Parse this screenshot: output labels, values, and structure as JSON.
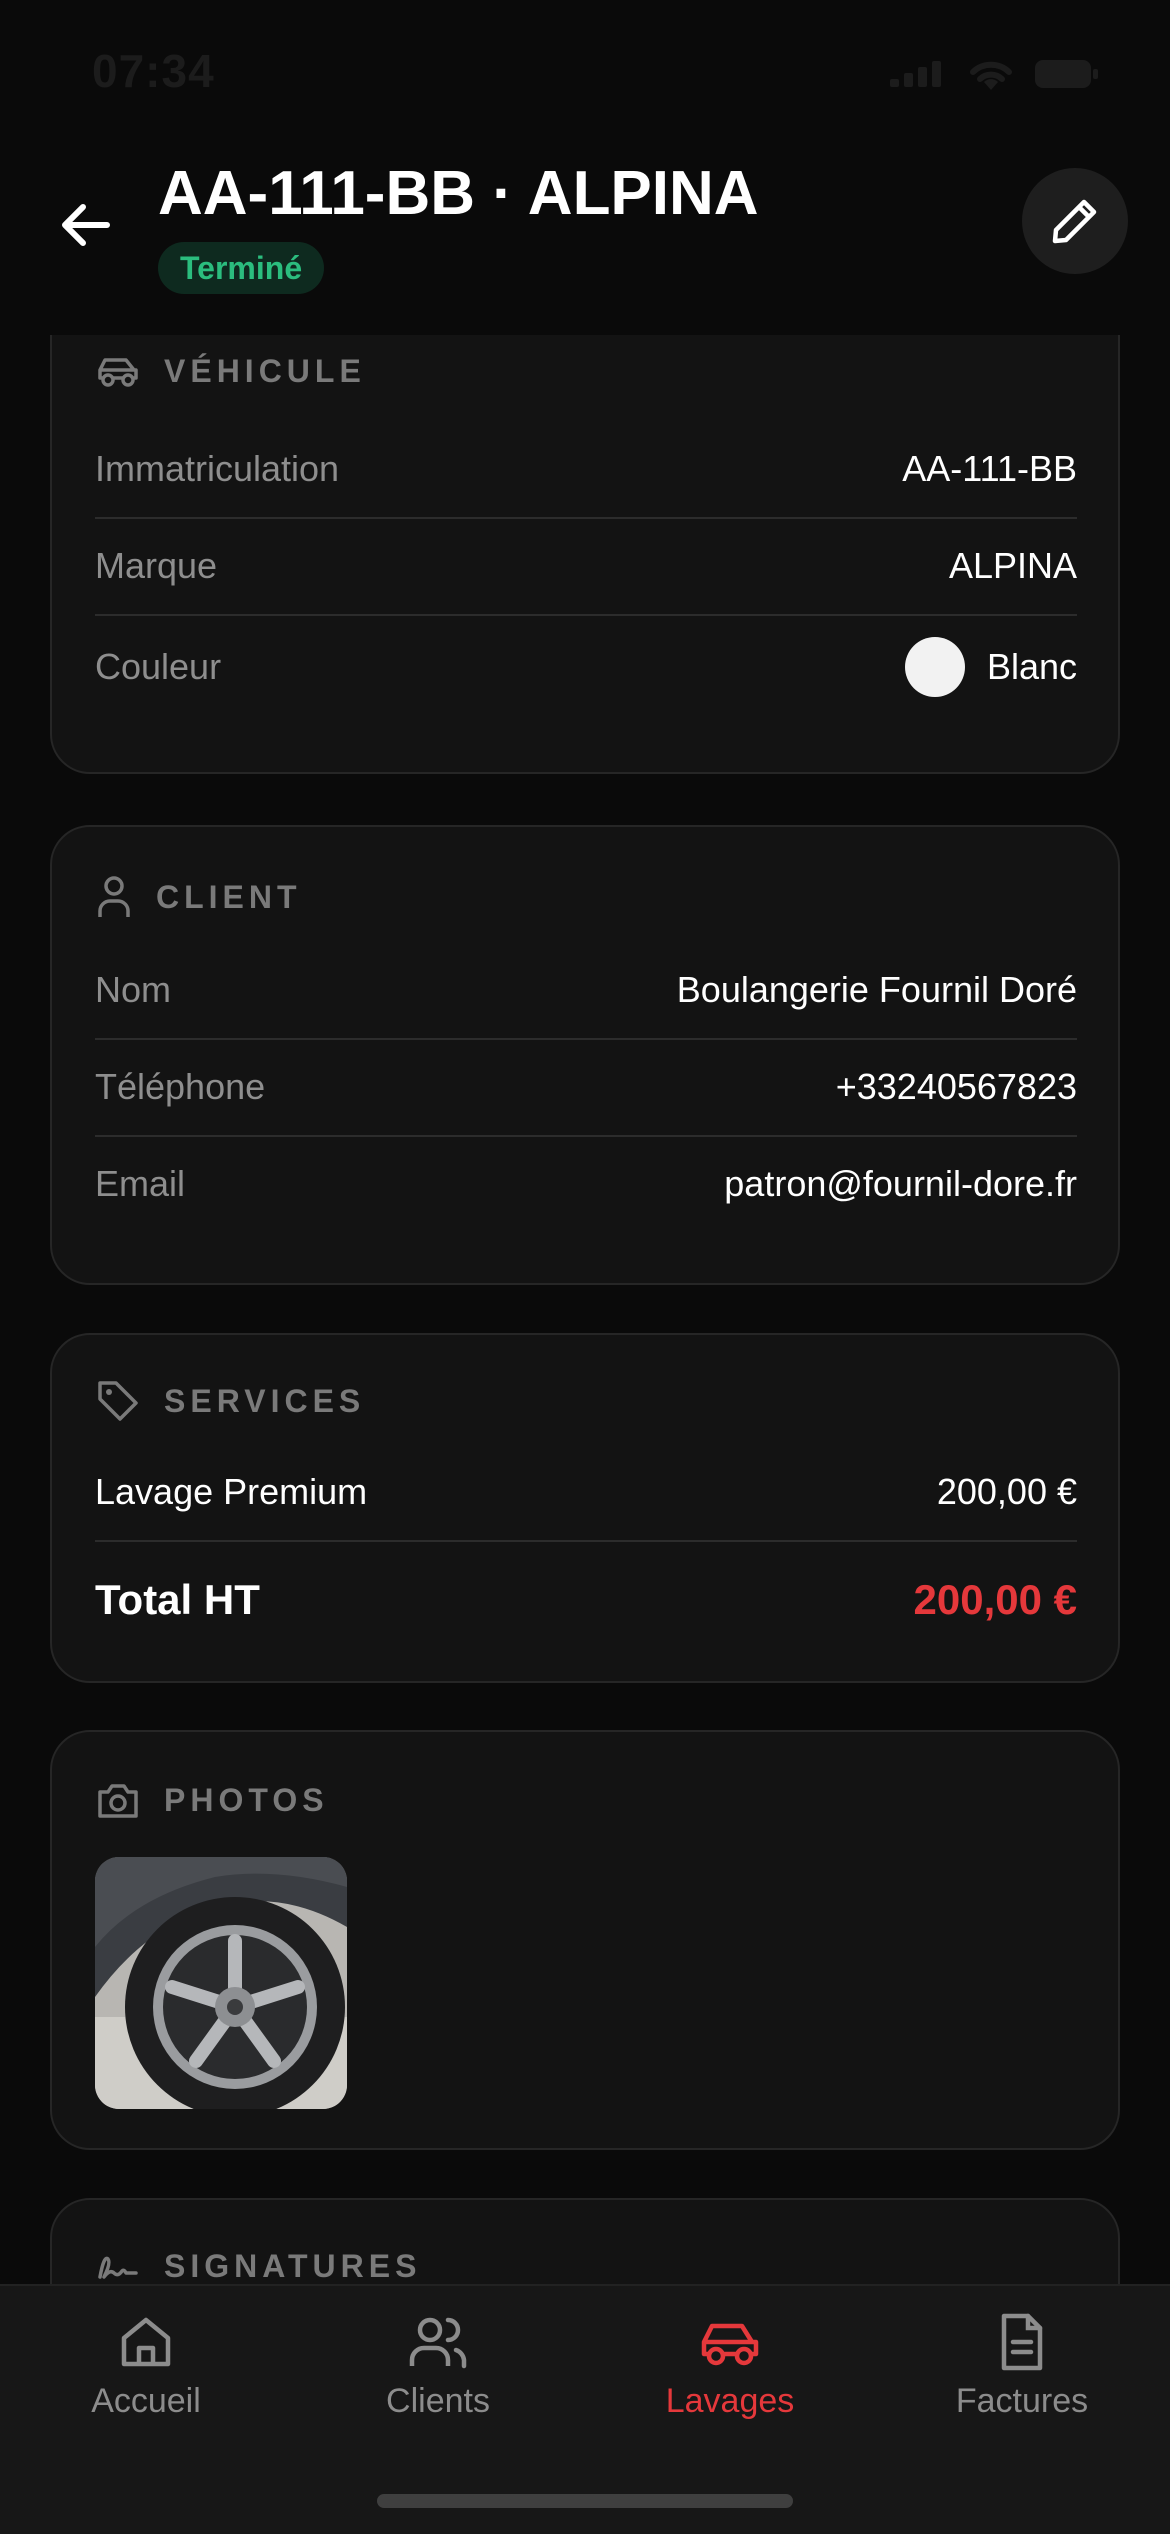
{
  "status_bar": {
    "time": "07:34"
  },
  "header": {
    "title": "AA-111-BB · ALPINA",
    "status_badge": "Terminé"
  },
  "vehicle": {
    "title": "VÉHICULE",
    "rows": [
      {
        "label": "Immatriculation",
        "value": "AA-111-BB"
      },
      {
        "label": "Marque",
        "value": "ALPINA"
      },
      {
        "label": "Couleur",
        "value": "Blanc",
        "swatch": "#f2f2f2"
      }
    ]
  },
  "client": {
    "title": "CLIENT",
    "rows": [
      {
        "label": "Nom",
        "value": "Boulangerie Fournil Doré"
      },
      {
        "label": "Téléphone",
        "value": "+33240567823"
      },
      {
        "label": "Email",
        "value": "patron@fournil-dore.fr"
      }
    ]
  },
  "services": {
    "title": "SERVICES",
    "items": [
      {
        "label": "Lavage Premium",
        "price": "200,00 €"
      }
    ],
    "total_label": "Total HT",
    "total_value": "200,00 €"
  },
  "photos": {
    "title": "PHOTOS"
  },
  "signatures": {
    "title": "SIGNATURES"
  },
  "tabbar": {
    "tabs": [
      {
        "label": "Accueil",
        "icon": "home-icon"
      },
      {
        "label": "Clients",
        "icon": "users-icon"
      },
      {
        "label": "Lavages",
        "icon": "car-icon",
        "active": true
      },
      {
        "label": "Factures",
        "icon": "invoice-icon"
      }
    ]
  },
  "colors": {
    "accent": "#e5383b",
    "success": "#2bbd7e",
    "background": "#0a0a0a",
    "card": "#131313"
  }
}
